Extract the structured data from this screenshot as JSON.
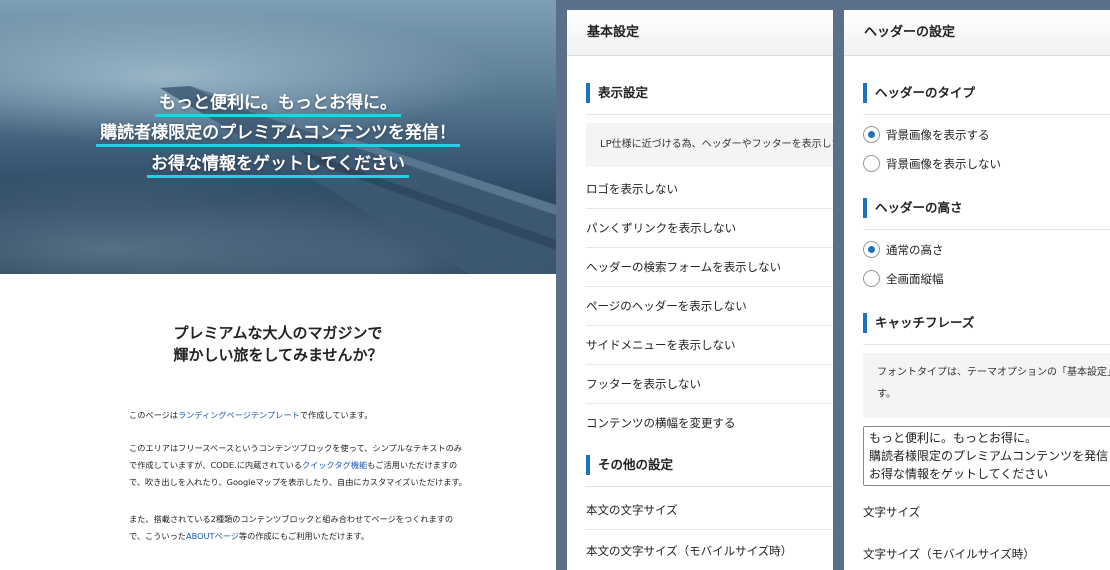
{
  "preview": {
    "hero": {
      "catch_lines": [
        "もっと便利に。もっとお得に。",
        "購読者様限定のプレミアムコンテンツを発信！",
        "お得な情報をゲットしてください"
      ]
    },
    "lead": [
      "プレミアムな大人のマガジンで",
      "輝かしい旅をしてみませんか？"
    ],
    "para1": {
      "before": "このページは",
      "link": "ランディングページテンプレート",
      "after": "で作成しています。"
    },
    "para2": {
      "before": "このエリアはフリースペースというコンテンツブロックを使って、シンプルなテキストのみで作成していますが、CODE.に内蔵されている",
      "link": "クイックタグ機能",
      "after": "もご活用いただけますので、吹き出しを入れたり、Googleマップを表示したり、自由にカスタマイズいただけます。"
    },
    "para3": {
      "before": "また、搭載されている2種類のコンテンツブロックと組み合わせてページをつくれますので、こういった",
      "link": "ABOUTページ",
      "after": "等の作成にもご利用いただけます。"
    }
  },
  "basic_panel": {
    "title": "基本設定",
    "display_section": "表示設定",
    "display_desc": "LP仕様に近づける為、ヘッダーやフッターを表示しない",
    "options": [
      "ロゴを表示しない",
      "パンくずリンクを表示しない",
      "ヘッダーの検索フォームを表示しない",
      "ページのヘッダーを表示しない",
      "サイドメニューを表示しない",
      "フッターを表示しない",
      "コンテンツの横幅を変更する"
    ],
    "other_section": "その他の設定",
    "other_options": [
      "本文の文字サイズ",
      "本文の文字サイズ（モバイルサイズ時）"
    ]
  },
  "header_panel": {
    "title": "ヘッダーの設定",
    "type_section": "ヘッダーのタイプ",
    "type_options": [
      "背景画像を表示する",
      "背景画像を表示しない"
    ],
    "type_selected": 0,
    "height_section": "ヘッダーの高さ",
    "height_options": [
      "通常の高さ",
      "全画面縦幅"
    ],
    "height_selected": 0,
    "catch_section": "キャッチフレーズ",
    "catch_desc_line1": "フォントタイプは、テーマオプションの「基本設定」",
    "catch_desc_line2": "す。",
    "catch_text": "もっと便利に。もっとお得に。\n購読者様限定のプレミアムコンテンツを発信\nお得な情報をゲットしてください",
    "font_size_label": "文字サイズ",
    "font_size_mobile_label": "文字サイズ（モバイルサイズ時）"
  },
  "colors": {
    "accent": "#1e73be",
    "underline": "#22d3e8",
    "link": "#1a55b5",
    "frame": "#5b6f8a"
  }
}
